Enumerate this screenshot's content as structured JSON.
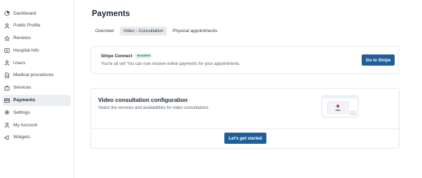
{
  "sidebar": {
    "items": [
      {
        "label": "Dashboard",
        "icon": "dashboard-icon",
        "active": false
      },
      {
        "label": "Public Profile",
        "icon": "user-icon",
        "active": false
      },
      {
        "label": "Reviews",
        "icon": "star-icon",
        "active": false
      },
      {
        "label": "Hospital Info",
        "icon": "hospital-icon",
        "active": false
      },
      {
        "label": "Users",
        "icon": "users-icon",
        "active": false
      },
      {
        "label": "Medical procedures",
        "icon": "document-icon",
        "active": false
      },
      {
        "label": "Services",
        "icon": "briefcase-icon",
        "active": false
      },
      {
        "label": "Payments",
        "icon": "credit-card-icon",
        "active": true
      },
      {
        "label": "Settings",
        "icon": "gear-icon",
        "active": false
      },
      {
        "label": "My Account",
        "icon": "account-icon",
        "active": false
      },
      {
        "label": "Widgets",
        "icon": "megaphone-icon",
        "active": false
      }
    ]
  },
  "main": {
    "title": "Payments",
    "tabs": [
      {
        "label": "Overview",
        "active": false
      },
      {
        "label": "Video - Consultation",
        "active": true
      },
      {
        "label": "Physical appointments",
        "active": false
      }
    ]
  },
  "stripe": {
    "name": "Stripe Connect",
    "badge": "Enabled",
    "description": "You're all set! You can now receive online payments for your appointments.",
    "button_label": "Go to Stripe"
  },
  "video_config": {
    "title": "Video consultation configuration",
    "description": "Select the services and availabilities for video consultations",
    "button_label": "Let's get started"
  },
  "colors": {
    "primary": "#1f5f99",
    "badge_text": "#2f7d48",
    "badge_bg": "#e4f3e8",
    "active_bg": "#eceff2"
  }
}
